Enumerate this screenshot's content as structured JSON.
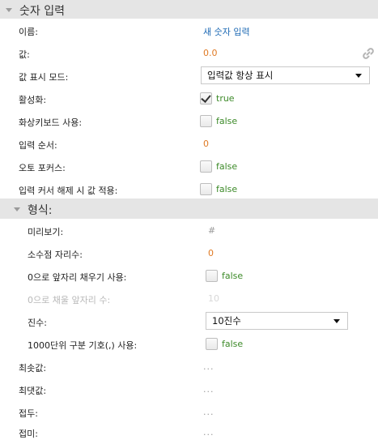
{
  "section_main": {
    "title": "숫자 입력"
  },
  "name": {
    "label": "이름:",
    "value": "새 숫자 입력"
  },
  "value": {
    "label": "값:",
    "value": "0.0",
    "icon": "link-icon"
  },
  "display_mode": {
    "label": "값 표시 모드:",
    "selected": "입력값 항상 표시"
  },
  "enabled": {
    "label": "활성화:",
    "checked": true,
    "text": "true"
  },
  "keyboard": {
    "label": "화상키보드 사용:",
    "checked": false,
    "text": "false"
  },
  "input_order": {
    "label": "입력 순서:",
    "value": "0"
  },
  "autofocus": {
    "label": "오토 포커스:",
    "checked": false,
    "text": "false"
  },
  "apply_on_blur": {
    "label": "입력 커서 해제 시 값 적용:",
    "checked": false,
    "text": "false"
  },
  "section_format": {
    "title": "형식:"
  },
  "preview": {
    "label": "미리보기:",
    "value": "#"
  },
  "decimal_places": {
    "label": "소수점 자리수:",
    "value": "0"
  },
  "zero_fill": {
    "label": "0으로 앞자리 채우기 사용:",
    "checked": false,
    "text": "false"
  },
  "zero_fill_digits": {
    "label": "0으로 채울 앞자리 수:",
    "value": "10"
  },
  "base": {
    "label": "진수:",
    "selected": "10진수"
  },
  "thousands_sep": {
    "label": "1000단위 구분 기호(,) 사용:",
    "checked": false,
    "text": "false"
  },
  "min_value": {
    "label": "최솟값:",
    "value": "..."
  },
  "max_value": {
    "label": "최댓값:",
    "value": "..."
  },
  "prefix": {
    "label": "접두:",
    "value": "..."
  },
  "suffix": {
    "label": "접미:",
    "value": "..."
  },
  "colors": {
    "header_bg": "#e5e5e5",
    "link": "#1f6bb5",
    "number": "#e07a24",
    "bool": "#3c8a28"
  }
}
